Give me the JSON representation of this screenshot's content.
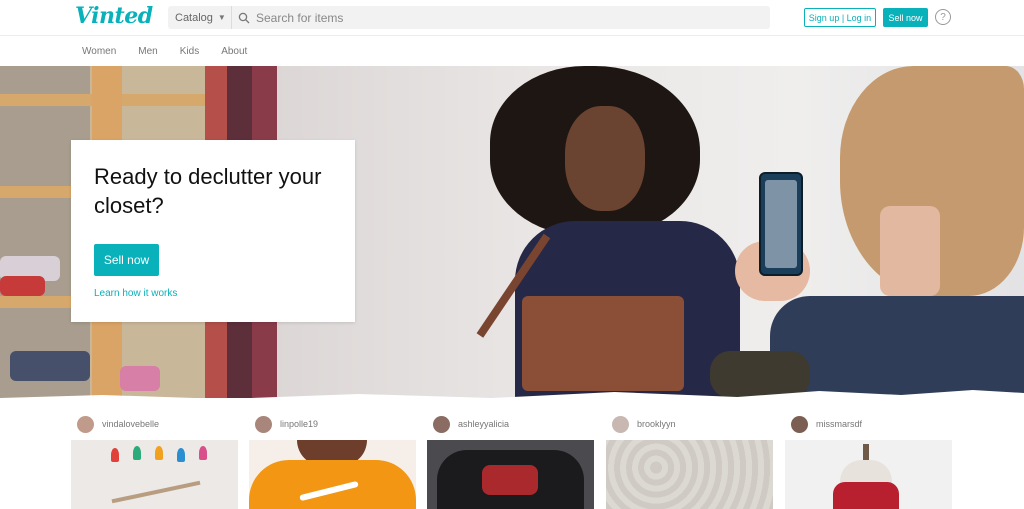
{
  "header": {
    "logo": "Vinted",
    "catalog_label": "Catalog",
    "search_placeholder": "Search for items",
    "signup_label": "Sign up | Log in",
    "sell_label": "Sell now",
    "help_icon": "?"
  },
  "nav": {
    "items": [
      {
        "label": "Women"
      },
      {
        "label": "Men"
      },
      {
        "label": "Kids"
      },
      {
        "label": "About"
      }
    ]
  },
  "hero": {
    "title": "Ready to declutter your closet?",
    "button_label": "Sell now",
    "link_label": "Learn how it works"
  },
  "feed": {
    "items": [
      {
        "username": "vindalovebelle",
        "avatar_color": "#c09a8a",
        "image_colors": [
          "#e9e6e4",
          "#c6ab8f"
        ]
      },
      {
        "username": "linpolle19",
        "avatar_color": "#a8867b",
        "image_colors": [
          "#f39a1c",
          "#ffffff"
        ]
      },
      {
        "username": "ashleyyalicia",
        "avatar_color": "#8a6c63",
        "image_colors": [
          "#1f1f21",
          "#b22b2b"
        ]
      },
      {
        "username": "brooklyyn",
        "avatar_color": "#c8b8b1",
        "image_colors": [
          "#d6d2cc",
          "#c7c1ba"
        ]
      },
      {
        "username": "missmarsdf",
        "avatar_color": "#7b5f53",
        "image_colors": [
          "#efefef",
          "#b82330"
        ]
      }
    ]
  },
  "colors": {
    "brand": "#09b1ba"
  }
}
